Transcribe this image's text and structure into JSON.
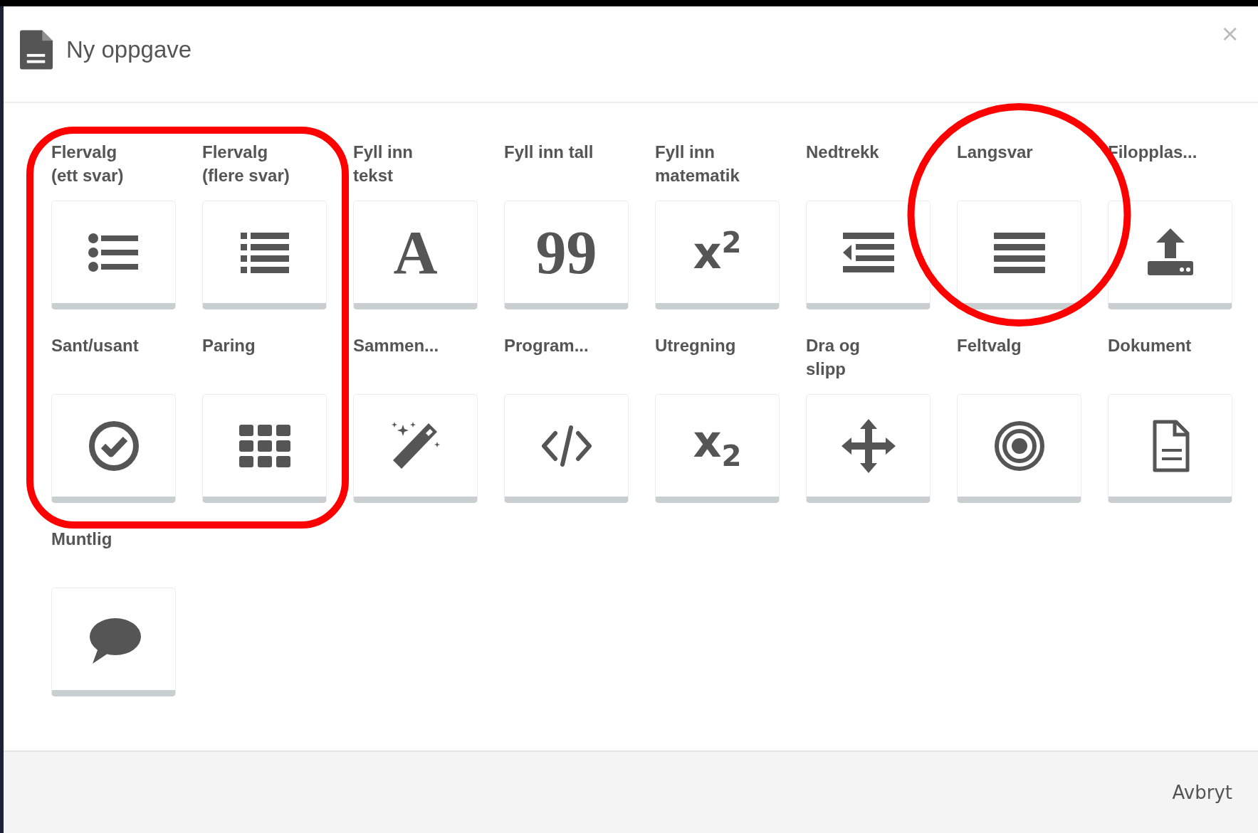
{
  "dialog": {
    "title": "Ny oppgave",
    "close": "×"
  },
  "task_types": [
    {
      "label": "Flervalg\n(ett svar)",
      "kind": "icon",
      "boxed": true,
      "circled": false
    },
    {
      "label": "Flervalg\n(flere svar)",
      "kind": "icon",
      "boxed": true,
      "circled": false
    },
    {
      "label": "Fyll inn\ntekst",
      "glyph": "A",
      "kind": "serif",
      "boxed": false,
      "circled": false
    },
    {
      "label": "Fyll inn tall",
      "glyph": "99",
      "kind": "serif",
      "boxed": false,
      "circled": false
    },
    {
      "label": "Fyll inn\nmatematik",
      "glyph": "x$^{2}$",
      "kind": "sans",
      "boxed": false,
      "circled": false
    },
    {
      "label": "Nedtrekk",
      "kind": "icon",
      "boxed": false,
      "circled": false
    },
    {
      "label": "Langsvar",
      "kind": "icon",
      "boxed": false,
      "circled": true
    },
    {
      "label": "Filopplas...",
      "kind": "icon",
      "boxed": false,
      "circled": false
    },
    {
      "label": "Sant/usant",
      "kind": "icon",
      "boxed": true,
      "circled": false
    },
    {
      "label": "Paring",
      "kind": "icon",
      "boxed": true,
      "circled": false
    },
    {
      "label": "Sammen...",
      "kind": "icon",
      "boxed": false,
      "circled": false
    },
    {
      "label": "Program...",
      "kind": "icon",
      "boxed": false,
      "circled": false
    },
    {
      "label": "Utregning",
      "glyph": "x$_{2}$",
      "kind": "sans",
      "boxed": false,
      "circled": false
    },
    {
      "label": "Dra og\nslipp",
      "kind": "icon",
      "boxed": false,
      "circled": false
    },
    {
      "label": "Feltvalg",
      "kind": "icon",
      "boxed": false,
      "circled": false
    },
    {
      "label": "Dokument",
      "kind": "icon",
      "boxed": false,
      "circled": false
    },
    {
      "label": "Muntlig",
      "kind": "icon",
      "boxed": false,
      "circled": false
    }
  ],
  "footer": {
    "cancel": "Avbryt"
  }
}
